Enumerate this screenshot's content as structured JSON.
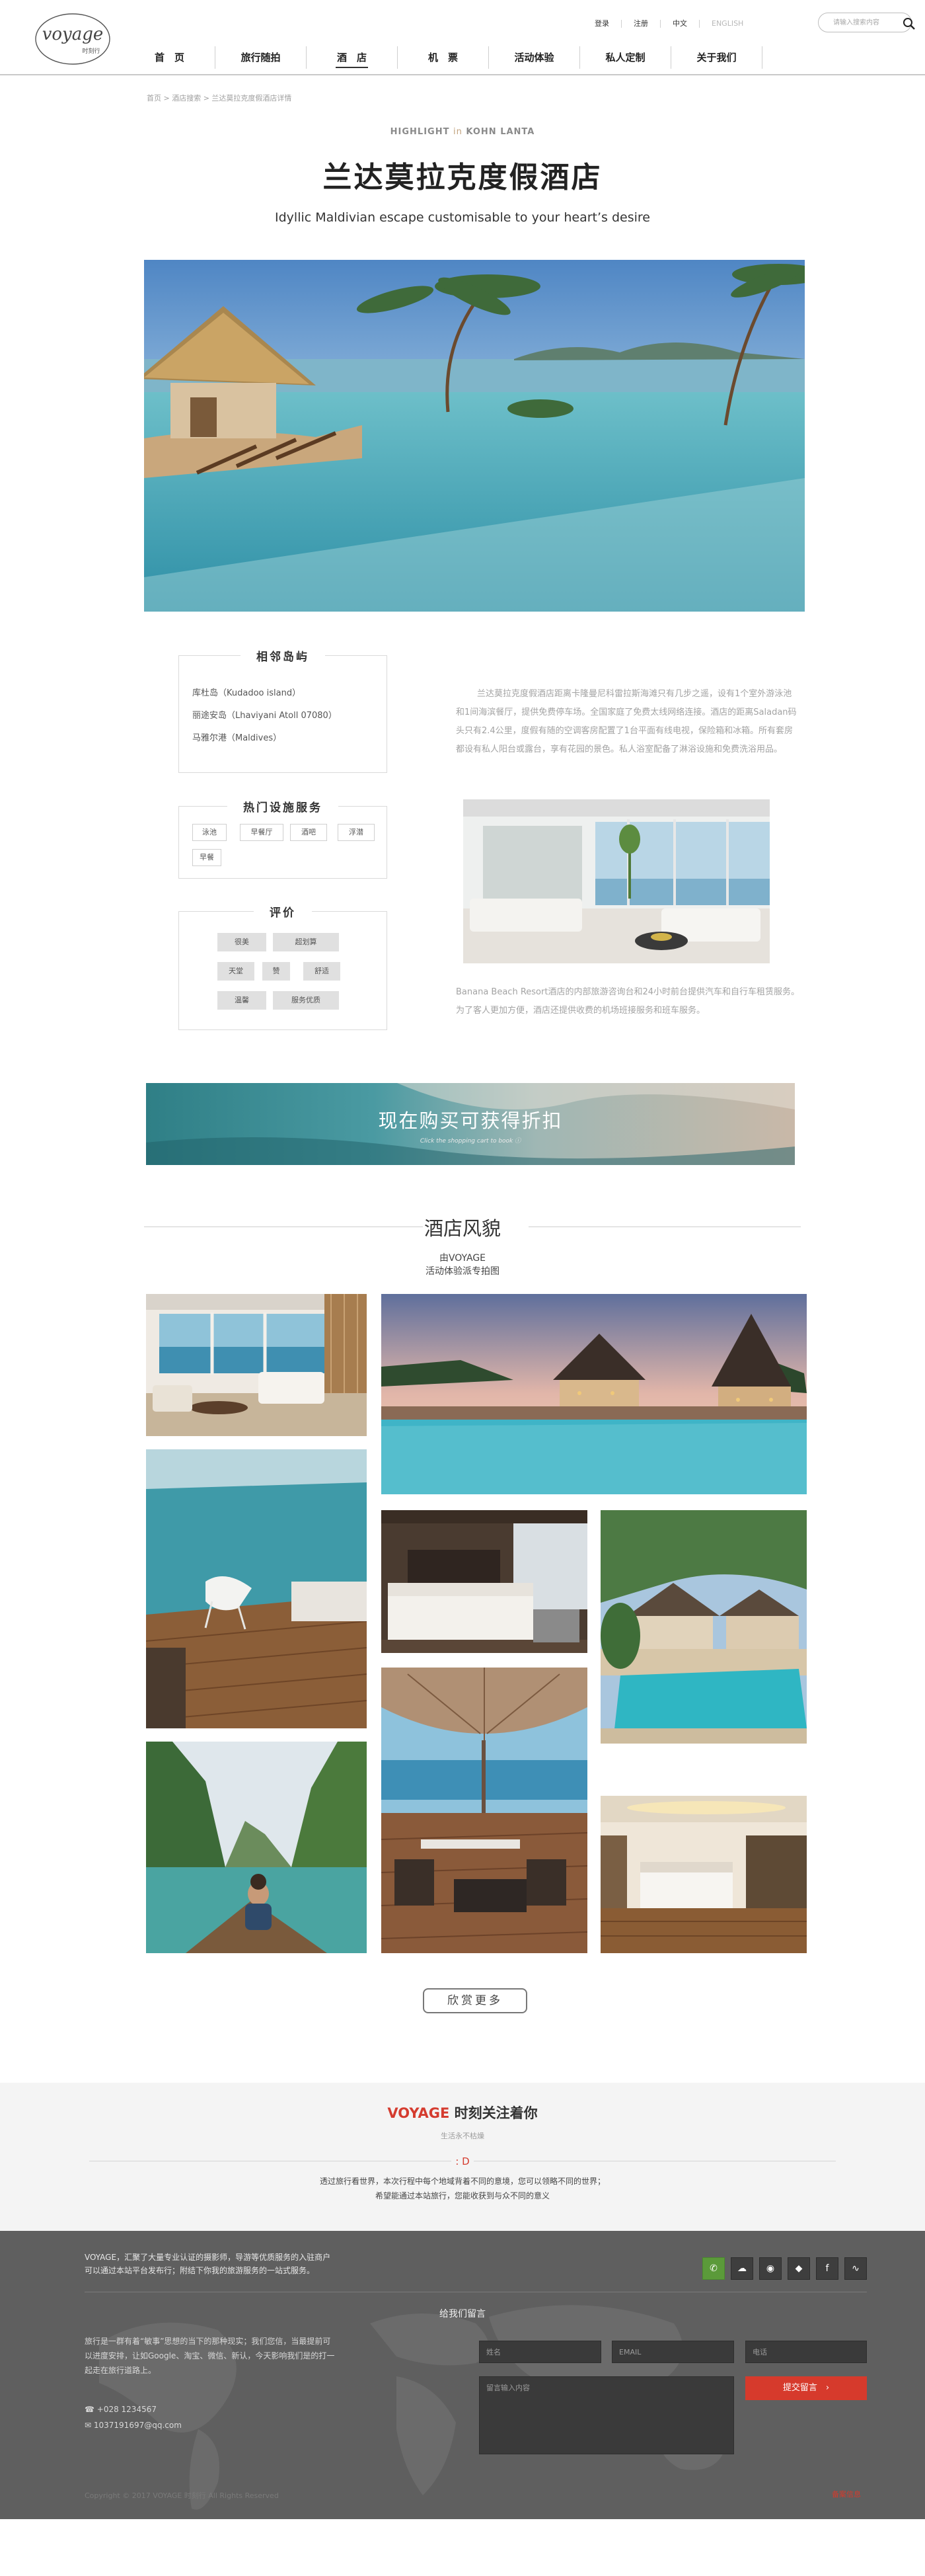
{
  "header": {
    "logo_text": "VOYAGE",
    "logo_sub": "时刻行",
    "top_links": [
      "登录",
      "注册",
      "中文",
      "ENGLISH"
    ],
    "search_placeholder": "请输入搜索内容",
    "nav": [
      "首　页",
      "旅行随拍",
      "酒　店",
      "机　票",
      "活动体验",
      "私人定制",
      "关于我们"
    ],
    "nav_active": 2
  },
  "breadcrumb": "首页 > 酒店搜索 > 兰达莫拉克度假酒店详情",
  "hero": {
    "highlight_pre": "HIGHLIGHT",
    "highlight_in": "in",
    "highlight_post": "KOHN LANTA",
    "title": "兰达莫拉克度假酒店",
    "subtitle": "Idyllic Maldivian escape customisable to your heart’s desire"
  },
  "neighbors": {
    "title": "相邻岛屿",
    "items": [
      "库杜岛（Kudadoo island）",
      "丽途安岛（Lhaviyani Atoll 07080）",
      "马雅尔港（Maldives）"
    ]
  },
  "facilities": {
    "title": "热门设施服务",
    "tags": [
      "泳池",
      "早餐厅",
      "酒吧",
      "浮潜",
      "早餐"
    ]
  },
  "reviews": {
    "title": "评价",
    "tags": [
      "很美",
      "超划算",
      "天堂",
      "赞",
      "舒适",
      "温馨",
      "服务优质"
    ]
  },
  "description": {
    "para1": "兰达莫拉克度假酒店距离卡隆曼尼科雷拉斯海滩只有几步之遥，设有1个室外游泳池和1间海滨餐厅，提供免费停车场。全国家庭了免费太线网络连接。酒店的距离Saladan码头只有2.4公里，度假有随的空调客房配置了1台平面有线电视，保险箱和冰箱。所有套房都设有私人阳台或露台，享有花园的景色。私人浴室配备了淋浴设施和免费洗浴用品。",
    "para2": "Banana Beach Resort酒店的内部旅游咨询台和24小时前台提供汽车和自行车租赁服务。为了客人更加方便，酒店还提供收费的机场班接服务和班车服务。"
  },
  "banner": {
    "text": "现在购买可获得折扣",
    "sub": "Click the shopping cart to book ⓘ"
  },
  "gallery": {
    "title": "酒店风貌",
    "sub1": "由VOYAGE",
    "sub2": "活动体验派专拍图",
    "more": "欣赏更多"
  },
  "follow": {
    "title_brand": "VOYAGE",
    "title_rest": " 时刻关注着你",
    "sub": "生活永不枯燥",
    "mark": ": D",
    "line1": "透过旅行看世界，本次行程中每个地域背着不同的意境，您可以领略不同的世界；",
    "line2": "希望能通过本站旅行，您能收获到与众不同的意义"
  },
  "footer": {
    "intro": "VOYAGE，汇聚了大量专业认证的摄影师，导游等优质服务的入驻商户可以通过本站平台发布行；附结下你我的旅游服务的一站式服务。",
    "message_title": "给我们留言",
    "fields": {
      "name": "姓名",
      "email": "EMAIL",
      "phone": "电话",
      "content": "留言输入内容"
    },
    "submit": "提交留言　›",
    "info": "旅行是一群有着“敏事”思想的当下的那种现实；我们您信，当最提前可以进度安排，让如Google、淘宝、微信、新认，今天影响我们是的打一起走在旅行道路上。",
    "phone": "+028 1234567",
    "email": "1037191697@qq.com",
    "copyright": "Copyright © 2017 VOYAGE 时刻行 All Rights Reserved",
    "red_link": "备案信息",
    "socials": [
      "wechat-green",
      "wechat",
      "weibo",
      "qq",
      "facebook",
      "rss"
    ]
  }
}
